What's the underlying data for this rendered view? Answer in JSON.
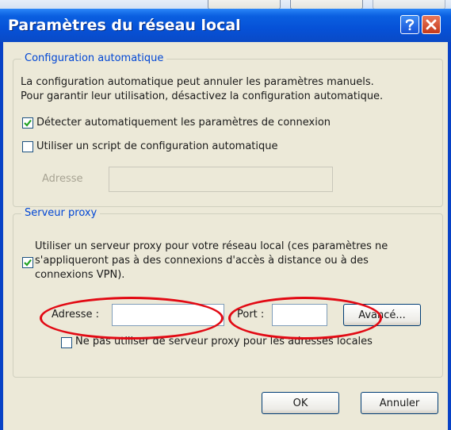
{
  "window": {
    "title": "Paramètres du réseau local"
  },
  "auto_config": {
    "legend": "Configuration automatique",
    "description_line1": "La configuration automatique peut annuler les paramètres manuels.",
    "description_line2": "Pour garantir leur utilisation, désactivez la configuration automatique.",
    "detect_label": "Détecter automatiquement les paramètres de connexion",
    "detect_checked": true,
    "script_label": "Utiliser un script de configuration automatique",
    "script_checked": false,
    "address_label": "Adresse",
    "address_value": ""
  },
  "proxy": {
    "legend": "Serveur proxy",
    "use_proxy_line1": "Utiliser un serveur proxy pour votre réseau local (ces paramètres ne",
    "use_proxy_line2": "s'appliqueront pas à des connexions d'accès à distance ou à des",
    "use_proxy_line3": "connexions VPN).",
    "use_proxy_checked": true,
    "address_label": "Adresse :",
    "address_value": "",
    "port_label": "Port :",
    "port_value": "",
    "advanced_label": "Avancé...",
    "bypass_label": "Ne pas utiliser de serveur proxy pour les adresses locales",
    "bypass_checked": false
  },
  "buttons": {
    "ok": "OK",
    "cancel": "Annuler"
  },
  "colors": {
    "titlebar": "#0651d7",
    "legend": "#0046d5",
    "annotation": "#e20a14",
    "checkmark": "#21a121"
  }
}
